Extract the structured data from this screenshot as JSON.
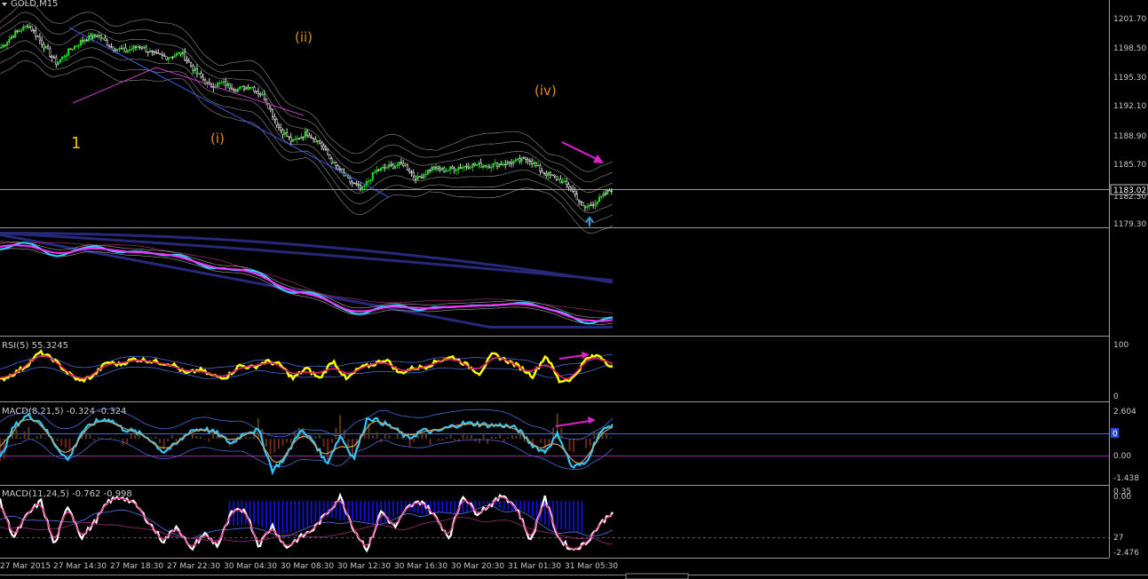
{
  "window": {
    "symbol_title": "GOLD,M15",
    "current_price": "1183.02",
    "price_label_overlay": "1182.50"
  },
  "panes": {
    "price": {
      "ticks": [
        "1201.70",
        "1198.50",
        "1195.30",
        "1192.10",
        "1188.90",
        "1185.70",
        "1179.30"
      ],
      "wave_labels": [
        {
          "label": "1",
          "color": "#e5c100",
          "size": 18
        },
        {
          "label": "(i)",
          "color": "#e08a1e",
          "size": 15
        },
        {
          "label": "(ii)",
          "color": "#e08a1e",
          "size": 15
        },
        {
          "label": "(iv)",
          "color": "#e08a1e",
          "size": 15
        }
      ]
    },
    "rsi": {
      "title": "RSI(5) 55.3245",
      "ticks": [
        "100",
        "0"
      ]
    },
    "macd1": {
      "title": "MACD(8,21,5) -0.324 -0.324",
      "ticks": [
        "2.604",
        "0.00",
        "-1.438"
      ],
      "marker": "0"
    },
    "macd2": {
      "title": "MACD(11,24,5) -0.762 -0.998",
      "ticks": [
        "0.35",
        "0.00",
        "27",
        "-2.476"
      ]
    }
  },
  "time_axis": {
    "labels": [
      "27 Mar 2015",
      "27 Mar 14:30",
      "27 Mar 18:30",
      "27 Mar 22:30",
      "30 Mar 04:30",
      "30 Mar 08:30",
      "30 Mar 12:30",
      "30 Mar 16:30",
      "30 Mar 20:30",
      "31 Mar 01:30",
      "31 Mar 05:30"
    ]
  },
  "colors": {
    "bull_candle": "#22dd22",
    "price_line": "#c8c8c8",
    "wave1": "#e5c100",
    "wave_sub": "#e08a1e",
    "arrow": "#e020d0",
    "rsi": "#ffff00",
    "signal": "#e0206a",
    "macd_cyan": "#30c8ff",
    "hist_blue": "#1010e0",
    "navy": "#28287a"
  },
  "chart_data": {
    "type": "line",
    "x_label_count": 11,
    "price_close": [
      1199.0,
      1200.6,
      1201.5,
      1199.4,
      1197.2,
      1198.8,
      1199.9,
      1200.4,
      1199.0,
      1198.6,
      1199.2,
      1198.2,
      1197.9,
      1198.4,
      1196.3,
      1194.7,
      1195.0,
      1194.3,
      1194.7,
      1193.4,
      1190.1,
      1188.4,
      1189.5,
      1188.3,
      1185.9,
      1184.2,
      1183.1,
      1185.2,
      1185.7,
      1186.0,
      1184.3,
      1185.5,
      1185.3,
      1185.6,
      1185.9,
      1185.8,
      1186.0,
      1186.2,
      1186.6,
      1185.1,
      1184.4,
      1183.4,
      1181.0,
      1181.9,
      1183.2
    ],
    "rsi": [
      32,
      44,
      60,
      85,
      72,
      48,
      30,
      40,
      66,
      62,
      72,
      70,
      66,
      62,
      44,
      52,
      40,
      38,
      60,
      56,
      68,
      62,
      35,
      55,
      35,
      70,
      33,
      55,
      62,
      72,
      45,
      55,
      58,
      70,
      76,
      62,
      45,
      82,
      70,
      58,
      40,
      80,
      30,
      35,
      72,
      80,
      55
    ],
    "macd1": [
      -0.3,
      1.6,
      2.3,
      1.9,
      0.6,
      -0.4,
      1.3,
      1.9,
      2.1,
      1.5,
      1.3,
      0.9,
      0.1,
      0.6,
      1.4,
      1.5,
      1.2,
      0.6,
      1.3,
      1.4,
      -1.0,
      -0.2,
      1.4,
      0.8,
      -0.6,
      1.1,
      -0.3,
      2.2,
      1.9,
      1.5,
      0.9,
      1.4,
      1.3,
      1.6,
      1.8,
      1.8,
      1.7,
      1.7,
      1.5,
      0.6,
      0.1,
      1.2,
      -0.8,
      -0.6,
      1.2,
      1.8
    ],
    "macd2": [
      0.0,
      -1.8,
      -0.7,
      0.0,
      -2.2,
      -0.2,
      -1.8,
      -1.0,
      0.0,
      0.2,
      -0.2,
      -1.1,
      -2.0,
      -1.2,
      -2.4,
      -1.6,
      -2.2,
      -0.6,
      -0.4,
      -2.2,
      -1.2,
      -2.3,
      -1.8,
      -1.4,
      -0.6,
      0.2,
      -1.4,
      -2.4,
      -0.5,
      -1.3,
      -0.3,
      0.0,
      -0.8,
      -1.8,
      0.3,
      -0.6,
      -0.2,
      0.3,
      -0.4,
      -2.0,
      0.2,
      -1.8,
      -2.4,
      -2.1,
      -1.2,
      -0.5
    ],
    "ylim_price": [
      1179.3,
      1203.5
    ],
    "ylim_rsi": [
      0,
      100
    ],
    "ylim_macd1": [
      -1.438,
      2.604
    ],
    "ylim_macd2": [
      -2.476,
      0.35
    ]
  }
}
